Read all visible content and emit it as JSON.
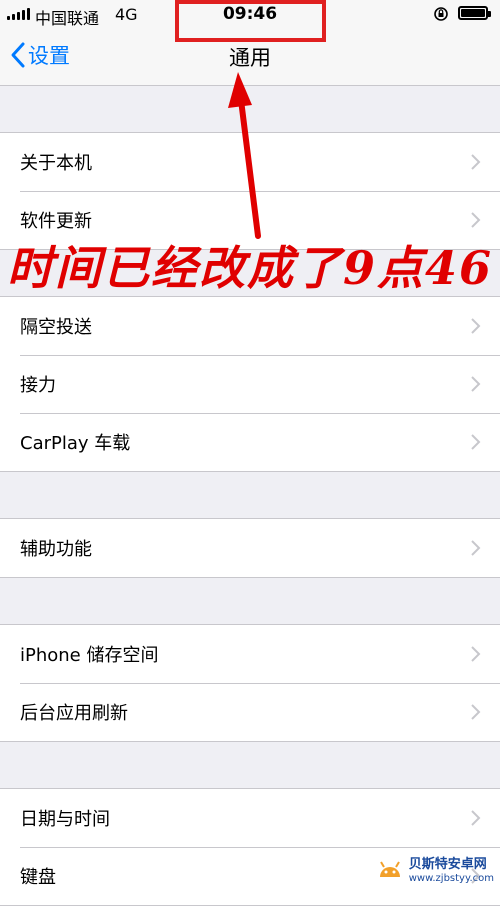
{
  "status_bar": {
    "carrier": "中国联通",
    "network": "4G",
    "time": "09:46"
  },
  "nav": {
    "back_label": "设置",
    "title": "通用"
  },
  "groups": [
    {
      "items": [
        "关于本机",
        "软件更新"
      ]
    },
    {
      "items": [
        "隔空投送",
        "接力",
        "CarPlay 车载"
      ]
    },
    {
      "items": [
        "辅助功能"
      ]
    },
    {
      "items": [
        "iPhone 储存空间",
        "后台应用刷新"
      ]
    },
    {
      "items": [
        "日期与时间",
        "键盘"
      ]
    }
  ],
  "annotation": {
    "text": "时间已经改成了9点46",
    "color": "#e00000"
  },
  "watermark": {
    "name": "贝斯特安卓网",
    "url": "www.zjbstyy.com"
  },
  "colors": {
    "accent": "#007aff",
    "background": "#efeff4",
    "separator": "#c8c7cc"
  }
}
